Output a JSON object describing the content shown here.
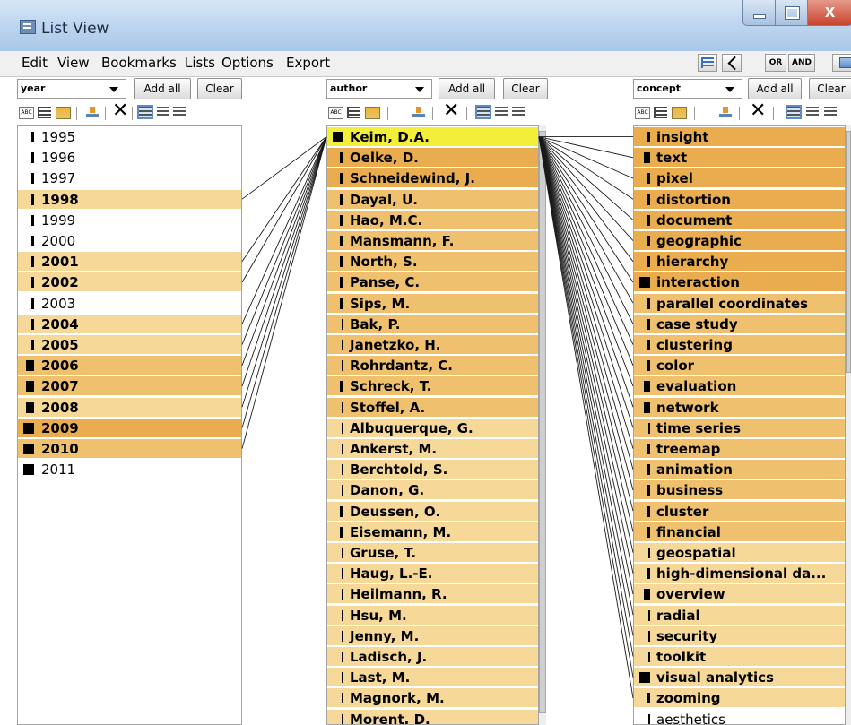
{
  "window": {
    "title": "List View",
    "minimize_icon": "minimize-icon",
    "maximize_icon": "maximize-icon",
    "close_icon": "close-icon",
    "close_label": "X"
  },
  "menu": [
    "Edit",
    "View",
    "Bookmarks",
    "Lists",
    "Options",
    "Export"
  ],
  "toolbar": {
    "or_label": "OR",
    "and_label": "AND"
  },
  "columns": {
    "year": {
      "dropdown": "year",
      "add_all": "Add all",
      "clear": "Clear",
      "items": [
        {
          "label": "1995",
          "level": 0,
          "bold": false,
          "mark": 0.25
        },
        {
          "label": "1996",
          "level": 0,
          "bold": false,
          "mark": 0.25
        },
        {
          "label": "1997",
          "level": 0,
          "bold": false,
          "mark": 0.25
        },
        {
          "label": "1998",
          "level": 1,
          "bold": true,
          "mark": 0.25
        },
        {
          "label": "1999",
          "level": 0,
          "bold": false,
          "mark": 0.25
        },
        {
          "label": "2000",
          "level": 0,
          "bold": false,
          "mark": 0.25
        },
        {
          "label": "2001",
          "level": 1,
          "bold": true,
          "mark": 0.25
        },
        {
          "label": "2002",
          "level": 1,
          "bold": true,
          "mark": 0.25
        },
        {
          "label": "2003",
          "level": 0,
          "bold": false,
          "mark": 0.25
        },
        {
          "label": "2004",
          "level": 1,
          "bold": true,
          "mark": 0.25
        },
        {
          "label": "2005",
          "level": 1,
          "bold": true,
          "mark": 0.25
        },
        {
          "label": "2006",
          "level": 2,
          "bold": true,
          "mark": 0.75
        },
        {
          "label": "2007",
          "level": 2,
          "bold": true,
          "mark": 0.75
        },
        {
          "label": "2008",
          "level": 1,
          "bold": true,
          "mark": 0.75
        },
        {
          "label": "2009",
          "level": 3,
          "bold": true,
          "mark": 1.0
        },
        {
          "label": "2010",
          "level": 2,
          "bold": true,
          "mark": 1.0
        },
        {
          "label": "2011",
          "level": 0,
          "bold": false,
          "mark": 1.0
        }
      ]
    },
    "author": {
      "dropdown": "author",
      "add_all": "Add all",
      "clear": "Clear",
      "items": [
        {
          "label": "Keim, D.A.",
          "level": 4,
          "bold": true,
          "mark": 1.0
        },
        {
          "label": "Oelke, D.",
          "level": 3,
          "bold": true,
          "mark": 0.35
        },
        {
          "label": "Schneidewind, J.",
          "level": 3,
          "bold": true,
          "mark": 0.35
        },
        {
          "label": "Dayal, U.",
          "level": 2,
          "bold": true,
          "mark": 0.35
        },
        {
          "label": "Hao, M.C.",
          "level": 2,
          "bold": true,
          "mark": 0.35
        },
        {
          "label": "Mansmann, F.",
          "level": 2,
          "bold": true,
          "mark": 0.35
        },
        {
          "label": "North, S.",
          "level": 2,
          "bold": true,
          "mark": 0.35
        },
        {
          "label": "Panse, C.",
          "level": 2,
          "bold": true,
          "mark": 0.35
        },
        {
          "label": "Sips, M.",
          "level": 2,
          "bold": true,
          "mark": 0.35
        },
        {
          "label": "Bak, P.",
          "level": 2,
          "bold": true,
          "mark": 0.15
        },
        {
          "label": "Janetzko, H.",
          "level": 2,
          "bold": true,
          "mark": 0.15
        },
        {
          "label": "Rohrdantz, C.",
          "level": 2,
          "bold": true,
          "mark": 0.15
        },
        {
          "label": "Schreck, T.",
          "level": 2,
          "bold": true,
          "mark": 0.35
        },
        {
          "label": "Stoffel, A.",
          "level": 2,
          "bold": true,
          "mark": 0.15
        },
        {
          "label": "Albuquerque, G.",
          "level": 1,
          "bold": true,
          "mark": 0.15
        },
        {
          "label": "Ankerst, M.",
          "level": 1,
          "bold": true,
          "mark": 0.15
        },
        {
          "label": "Berchtold, S.",
          "level": 1,
          "bold": true,
          "mark": 0.15
        },
        {
          "label": "Danon, G.",
          "level": 1,
          "bold": true,
          "mark": 0.15
        },
        {
          "label": "Deussen, O.",
          "level": 1,
          "bold": true,
          "mark": 0.35
        },
        {
          "label": "Eisemann, M.",
          "level": 1,
          "bold": true,
          "mark": 0.35
        },
        {
          "label": "Gruse, T.",
          "level": 1,
          "bold": true,
          "mark": 0.15
        },
        {
          "label": "Haug, L.-E.",
          "level": 1,
          "bold": true,
          "mark": 0.15
        },
        {
          "label": "Heilmann, R.",
          "level": 1,
          "bold": true,
          "mark": 0.15
        },
        {
          "label": "Hsu, M.",
          "level": 1,
          "bold": true,
          "mark": 0.15
        },
        {
          "label": "Jenny, M.",
          "level": 1,
          "bold": true,
          "mark": 0.15
        },
        {
          "label": "Ladisch, J.",
          "level": 1,
          "bold": true,
          "mark": 0.15
        },
        {
          "label": "Last, M.",
          "level": 1,
          "bold": true,
          "mark": 0.15
        },
        {
          "label": "Magnork, M.",
          "level": 1,
          "bold": true,
          "mark": 0.15
        },
        {
          "label": "Morent, D.",
          "level": 1,
          "bold": true,
          "mark": 0.15
        }
      ]
    },
    "concept": {
      "dropdown": "concept",
      "add_all": "Add all",
      "clear": "Clear",
      "items": [
        {
          "label": "insight",
          "level": 3,
          "bold": true,
          "mark": 0.35
        },
        {
          "label": "text",
          "level": 3,
          "bold": true,
          "mark": 0.55
        },
        {
          "label": "pixel",
          "level": 3,
          "bold": true,
          "mark": 0.35
        },
        {
          "label": "distortion",
          "level": 3,
          "bold": true,
          "mark": 0.35
        },
        {
          "label": "document",
          "level": 3,
          "bold": true,
          "mark": 0.35
        },
        {
          "label": "geographic",
          "level": 3,
          "bold": true,
          "mark": 0.35
        },
        {
          "label": "hierarchy",
          "level": 3,
          "bold": true,
          "mark": 0.35
        },
        {
          "label": "interaction",
          "level": 3,
          "bold": true,
          "mark": 1.0
        },
        {
          "label": "parallel coordinates",
          "level": 2,
          "bold": true,
          "mark": 0.35
        },
        {
          "label": "case study",
          "level": 2,
          "bold": true,
          "mark": 0.35
        },
        {
          "label": "clustering",
          "level": 2,
          "bold": true,
          "mark": 0.35
        },
        {
          "label": "color",
          "level": 2,
          "bold": true,
          "mark": 0.35
        },
        {
          "label": "evaluation",
          "level": 2,
          "bold": true,
          "mark": 0.55
        },
        {
          "label": "network",
          "level": 2,
          "bold": true,
          "mark": 0.55
        },
        {
          "label": "time series",
          "level": 2,
          "bold": true,
          "mark": 0.15
        },
        {
          "label": "treemap",
          "level": 2,
          "bold": true,
          "mark": 0.35
        },
        {
          "label": "animation",
          "level": 2,
          "bold": true,
          "mark": 0.35
        },
        {
          "label": "business",
          "level": 2,
          "bold": true,
          "mark": 0.35
        },
        {
          "label": "cluster",
          "level": 2,
          "bold": true,
          "mark": 0.35
        },
        {
          "label": "financial",
          "level": 2,
          "bold": true,
          "mark": 0.35
        },
        {
          "label": "geospatial",
          "level": 1,
          "bold": true,
          "mark": 0.15
        },
        {
          "label": "high-dimensional da...",
          "level": 1,
          "bold": true,
          "mark": 0.35
        },
        {
          "label": "overview",
          "level": 1,
          "bold": true,
          "mark": 0.55
        },
        {
          "label": "radial",
          "level": 1,
          "bold": true,
          "mark": 0.15
        },
        {
          "label": "security",
          "level": 1,
          "bold": true,
          "mark": 0.15
        },
        {
          "label": "toolkit",
          "level": 1,
          "bold": true,
          "mark": 0.15
        },
        {
          "label": "visual analytics",
          "level": 1,
          "bold": true,
          "mark": 1.0
        },
        {
          "label": "zooming",
          "level": 1,
          "bold": true,
          "mark": 0.35
        },
        {
          "label": "aesthetics",
          "level": 0,
          "bold": false,
          "mark": 0.15
        }
      ]
    }
  },
  "colors": {
    "level0": "#ffffff",
    "level1": "#f6d898",
    "level2": "#efc06e",
    "level3": "#e9ad4f",
    "selected": "#f3ee3a",
    "link_line": "#1a1a1a"
  }
}
